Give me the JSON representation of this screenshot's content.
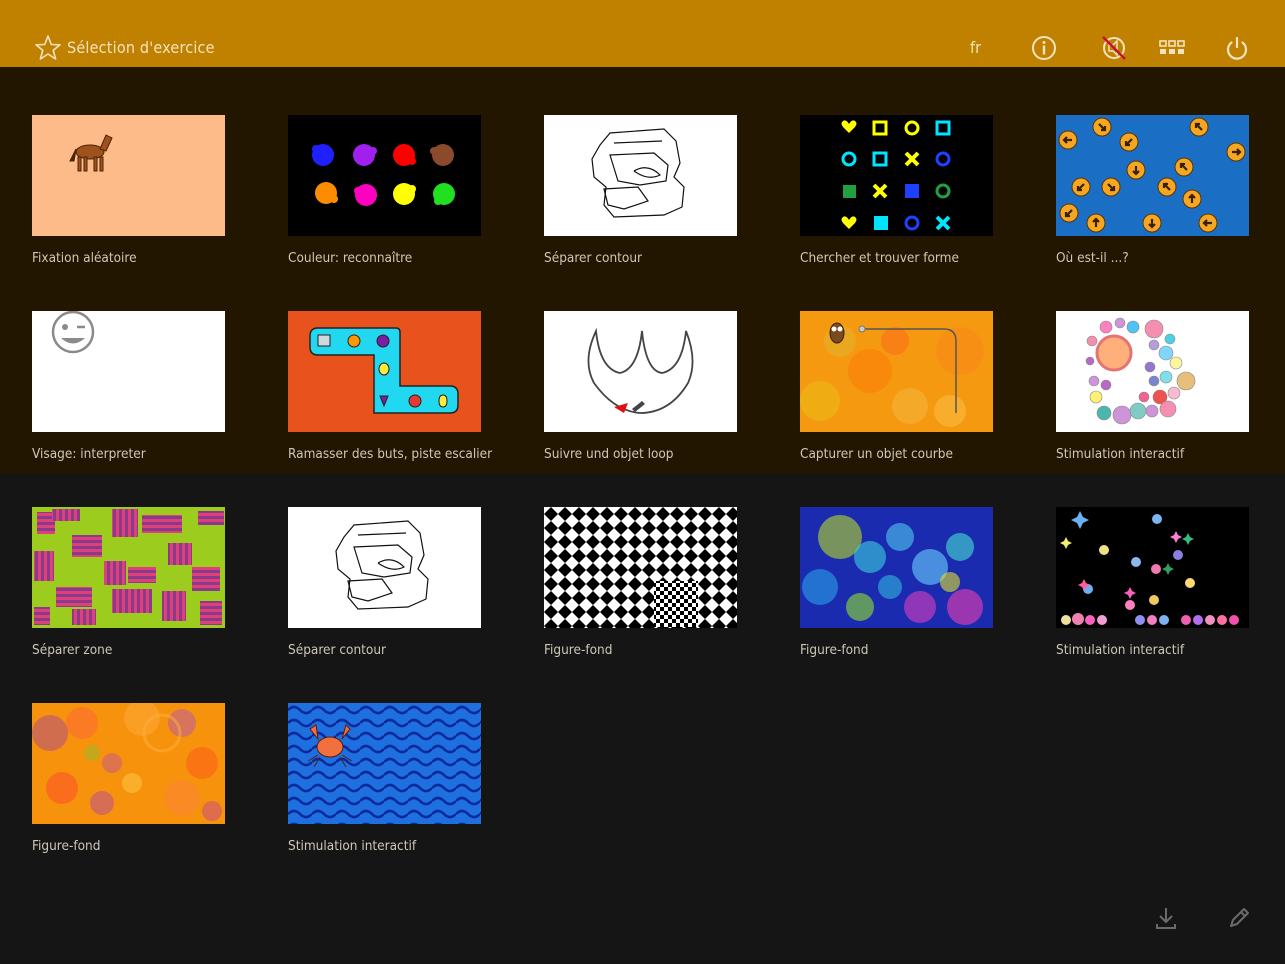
{
  "header": {
    "title": "Sélection d'exercice",
    "language": "fr",
    "icons": [
      "star-icon",
      "info-icon",
      "no-sound-icon",
      "grid-icon",
      "power-icon"
    ]
  },
  "exercises": [
    {
      "label": "Fixation aléatoire",
      "thumb": "horse"
    },
    {
      "label": "Couleur: reconnaître",
      "thumb": "paint-splats"
    },
    {
      "label": "Séparer contour",
      "thumb": "contour"
    },
    {
      "label": "Chercher et trouver forme",
      "thumb": "shapes"
    },
    {
      "label": "Où est-il ...?",
      "thumb": "arrows"
    },
    {
      "label": "Visage: interpreter",
      "thumb": "face"
    },
    {
      "label": "Ramasser des buts, piste escalier",
      "thumb": "stair-track"
    },
    {
      "label": "Suivre und objet loop",
      "thumb": "loop"
    },
    {
      "label": "Capturer un objet courbe",
      "thumb": "owl-curve"
    },
    {
      "label": "Stimulation interactif",
      "thumb": "circle-bubbles"
    },
    {
      "label": "Séparer zone",
      "thumb": "stripes-zone"
    },
    {
      "label": "Séparer contour",
      "thumb": "contour"
    },
    {
      "label": "Figure-fond",
      "thumb": "checker"
    },
    {
      "label": "Figure-fond",
      "thumb": "blue-bokeh"
    },
    {
      "label": "Stimulation interactif",
      "thumb": "dark-confetti"
    },
    {
      "label": "Figure-fond",
      "thumb": "orange-bokeh"
    },
    {
      "label": "Stimulation interactif",
      "thumb": "crab-waves"
    }
  ],
  "footer": {
    "icons": [
      "download-icon",
      "pencil-icon"
    ]
  },
  "colors": {
    "header": "#c18100",
    "band": "#231600",
    "background": "#151515",
    "label": "#cfc7b7"
  }
}
